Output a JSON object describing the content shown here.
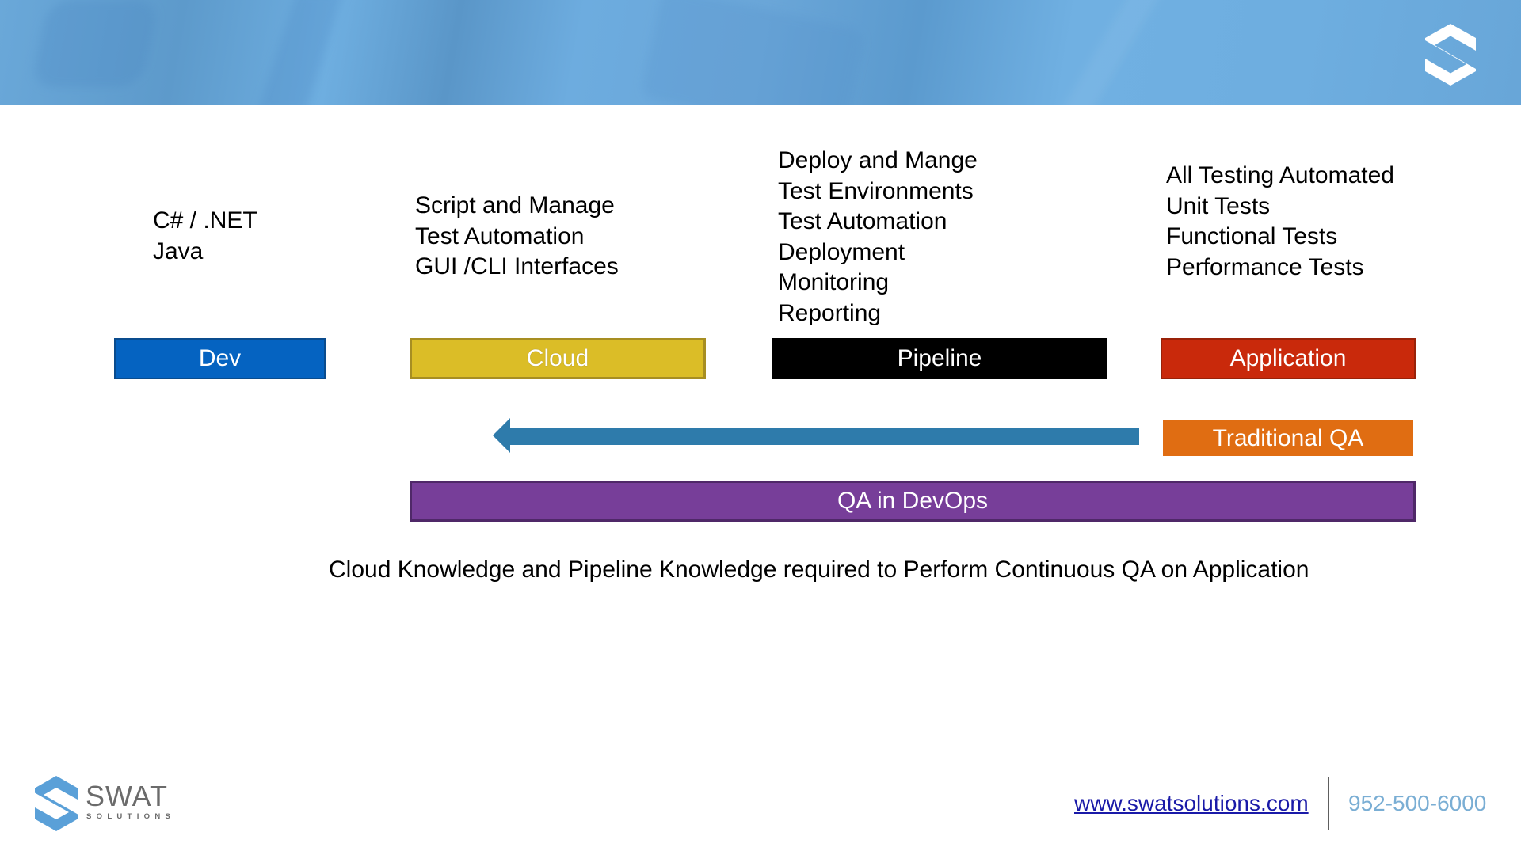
{
  "banner": {
    "logo_icon": "swat-s-hexagon-logo"
  },
  "columns": [
    {
      "name": "dev",
      "label": "Dev",
      "color": "#0563c1",
      "details": [
        "C# / .NET",
        "Java"
      ]
    },
    {
      "name": "cloud",
      "label": "Cloud",
      "color": "#dbbd27",
      "details": [
        "Script and Manage",
        "Test Automation",
        "GUI /CLI Interfaces"
      ]
    },
    {
      "name": "pipeline",
      "label": "Pipeline",
      "color": "#000000",
      "details": [
        "Deploy and Mange",
        "Test Environments",
        "Test Automation",
        "Deployment",
        "Monitoring",
        "Reporting"
      ]
    },
    {
      "name": "application",
      "label": "Application",
      "color": "#c9290b",
      "details": [
        "All Testing Automated",
        "Unit Tests",
        "Functional Tests",
        "Performance Tests"
      ]
    }
  ],
  "shift_arrow": {
    "direction": "left",
    "color": "#2e7bab",
    "from": "Traditional QA",
    "to": "Cloud"
  },
  "traditional_qa": {
    "label": "Traditional QA",
    "color": "#e06d12"
  },
  "qa_in_devops": {
    "label": "QA in DevOps",
    "color": "#773e99"
  },
  "caption": "Cloud Knowledge and Pipeline Knowledge required to Perform Continuous QA on Application",
  "footer": {
    "brand": "SWAT",
    "brand_sub": "SOLUTIONS",
    "website": "www.swatsolutions.com",
    "phone": "952-500-6000"
  }
}
